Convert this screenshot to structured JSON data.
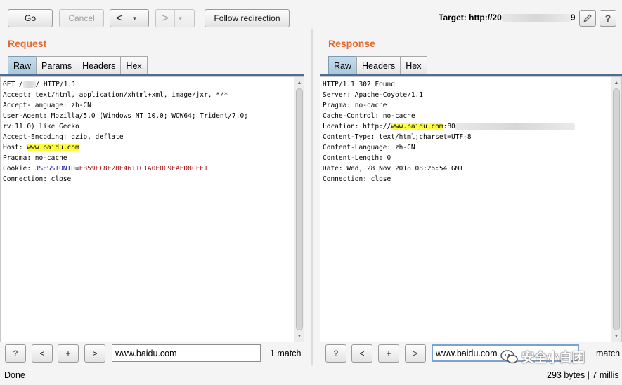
{
  "toolbar": {
    "go": "Go",
    "cancel": "Cancel",
    "back_arrow": "<",
    "forward_arrow": ">",
    "dropdown": "▼",
    "follow": "Follow redirection",
    "target_prefix": "Target: http://20",
    "target_suffix": "9",
    "edit_icon": "pencil-icon",
    "help_icon": "question-icon",
    "help_glyph": "?"
  },
  "request": {
    "title": "Request",
    "tabs": [
      "Raw",
      "Params",
      "Headers",
      "Hex"
    ],
    "active_tab": "Raw",
    "lines": {
      "l1a": "GET /",
      "l1b": "/ HTTP/1.1",
      "l2": "Accept: text/html, application/xhtml+xml, image/jxr, */*",
      "l3": "Accept-Language: zh-CN",
      "l4": "User-Agent: Mozilla/5.0 (Windows NT 10.0; WOW64; Trident/7.0;",
      "l5": "rv:11.0) like Gecko",
      "l6": "Accept-Encoding: gzip, deflate",
      "l7a": "Host: ",
      "l7b": "www.baidu.com",
      "l8": "Pragma: no-cache",
      "l9a": "Cookie: ",
      "l9b": "JSESSIONID",
      "l9c": "=",
      "l9d": "EB59FC8E28E4611C1A0E0C9EAED8CFE1",
      "l10": "Connection: close"
    },
    "search": {
      "help": "?",
      "prev": "<",
      "add": "+",
      "next": ">",
      "value": "www.baidu.com",
      "matches": "1 match"
    }
  },
  "response": {
    "title": "Response",
    "tabs": [
      "Raw",
      "Headers",
      "Hex"
    ],
    "active_tab": "Raw",
    "lines": {
      "l1": "HTTP/1.1 302 Found",
      "l2": "Server: Apache-Coyote/1.1",
      "l3": "Pragma: no-cache",
      "l4": "Cache-Control: no-cache",
      "l5a": "Location: http://",
      "l5b": "www.baidu.com",
      "l5c": ":80",
      "l6": "Content-Type: text/html;charset=UTF-8",
      "l7": "Content-Language: zh-CN",
      "l8": "Content-Length: 0",
      "l9": "Date: Wed, 28 Nov 2018 08:26:54 GMT",
      "l10": "Connection: close"
    },
    "search": {
      "help": "?",
      "prev": "<",
      "add": "+",
      "next": ">",
      "value": "www.baidu.com",
      "matches": "match"
    }
  },
  "status": {
    "left": "Done",
    "right": "293 bytes | 7 millis"
  },
  "watermark": {
    "text": "安全小白团",
    "icon": "wechat-icon"
  },
  "colors": {
    "title": "#e8672e",
    "highlight": "#ffff40",
    "active_tab": "#a9c7dd"
  }
}
